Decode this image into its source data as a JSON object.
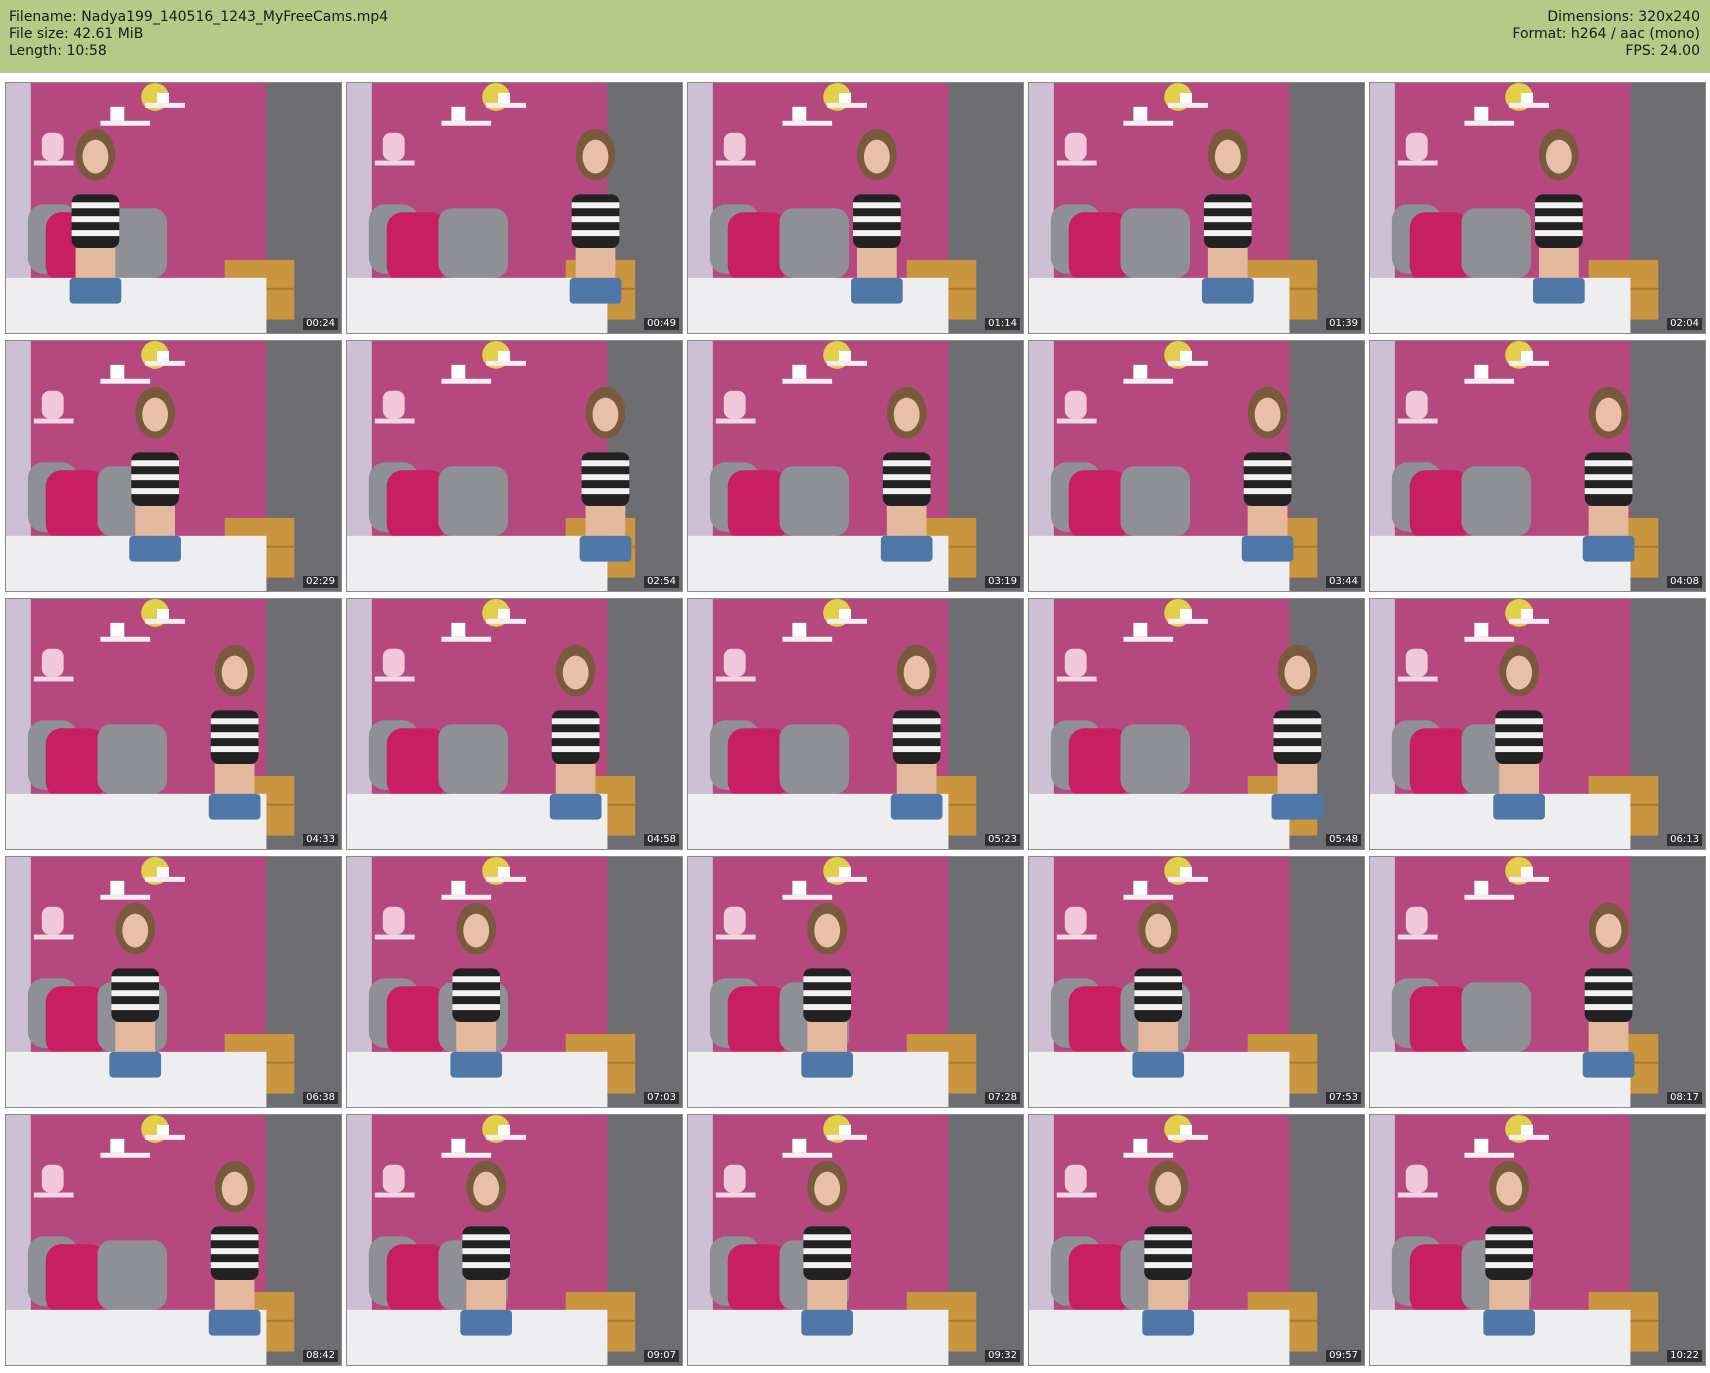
{
  "info": {
    "filename_line": "Filename: Nadya199_140516_1243_MyFreeCams.mp4",
    "filesize_line": "File size: 42.61 MiB",
    "length_line": "Length: 10:58",
    "dimensions_line": "Dimensions: 320x240",
    "format_line": "Format: h264 / aac (mono)",
    "fps_line": "FPS: 24.00"
  },
  "colors": {
    "header_bg": "#b3cb87",
    "wall_pink": "#b5497f",
    "wall_grey": "#6e6e72",
    "bed_white": "#eeeef0",
    "pillow_pink": "#c81e62",
    "pillow_grey": "#8e9096",
    "nightstand": "#c9953f",
    "lamp_yellow": "#e2cf4a"
  },
  "frames": [
    {
      "time": "00:24"
    },
    {
      "time": "00:49"
    },
    {
      "time": "01:14"
    },
    {
      "time": "01:39"
    },
    {
      "time": "02:04"
    },
    {
      "time": "02:29"
    },
    {
      "time": "02:54"
    },
    {
      "time": "03:19"
    },
    {
      "time": "03:44"
    },
    {
      "time": "04:08"
    },
    {
      "time": "04:33"
    },
    {
      "time": "04:58"
    },
    {
      "time": "05:23"
    },
    {
      "time": "05:48"
    },
    {
      "time": "06:13"
    },
    {
      "time": "06:38"
    },
    {
      "time": "07:03"
    },
    {
      "time": "07:28"
    },
    {
      "time": "07:53"
    },
    {
      "time": "08:17"
    },
    {
      "time": "08:42"
    },
    {
      "time": "09:07"
    },
    {
      "time": "09:32"
    },
    {
      "time": "09:57"
    },
    {
      "time": "10:22"
    }
  ]
}
